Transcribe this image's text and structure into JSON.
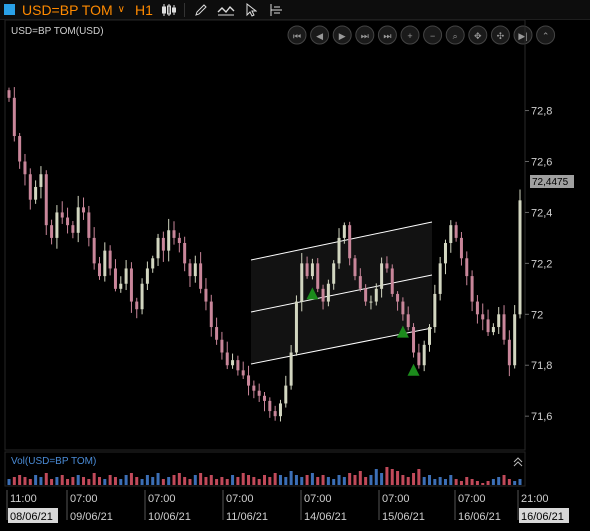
{
  "toolbar": {
    "symbol": "USD=BP TOM",
    "timeframe": "H1",
    "icons": [
      "candlestick-icon",
      "pencil-icon",
      "line-style-icon",
      "cursor-icon",
      "indicator-icon"
    ]
  },
  "chart": {
    "title": "USD=BP TOM(USD)",
    "volume_title": "Vol(USD=BP TOM)",
    "last_price": "72,4475",
    "nav_buttons": [
      "first-icon",
      "prev-icon",
      "play-icon",
      "next-icon",
      "last-icon",
      "zoom-in-icon",
      "zoom-out-icon",
      "zoom-area-icon",
      "scroll-icon",
      "fit-icon",
      "end-icon",
      "collapse-icon"
    ],
    "colors": {
      "up": "#d2d6c0",
      "down": "#c9869a",
      "vol_up": "#3c6fb6",
      "vol_down": "#c14a5a",
      "marker": "#1c8b1c",
      "last_price_bg": "#a0a0a0"
    }
  },
  "time_axis": {
    "times": [
      "11:00",
      "07:00",
      "07:00",
      "07:00",
      "07:00",
      "07:00",
      "07:00",
      "21:00"
    ],
    "dates": [
      "08/06/21",
      "09/06/21",
      "10/06/21",
      "11/06/21",
      "14/06/21",
      "15/06/21",
      "16/06/21",
      "16/06/21"
    ]
  },
  "chart_data": {
    "type": "candlestick",
    "y_ticks": [
      "72,8",
      "72,6",
      "72,4",
      "72,2",
      "72",
      "71,8",
      "71,6"
    ],
    "ylim": [
      71.53,
      72.92
    ],
    "candles": [
      72.85,
      72.7,
      72.6,
      72.55,
      72.45,
      72.5,
      72.55,
      72.35,
      72.3,
      72.4,
      72.38,
      72.35,
      72.32,
      72.42,
      72.4,
      72.3,
      72.2,
      72.15,
      72.25,
      72.18,
      72.1,
      72.12,
      72.18,
      72.05,
      72.02,
      72.12,
      72.18,
      72.22,
      72.3,
      72.25,
      72.33,
      72.3,
      72.28,
      72.2,
      72.15,
      72.2,
      72.1,
      72.05,
      71.95,
      71.9,
      71.85,
      71.8,
      71.82,
      71.78,
      71.76,
      71.72,
      71.7,
      71.68,
      71.66,
      71.62,
      71.6,
      71.65,
      71.72,
      71.85,
      72.05,
      72.2,
      72.15,
      72.2,
      72.1,
      72.05,
      72.12,
      72.2,
      72.3,
      72.35,
      72.22,
      72.15,
      72.1,
      72.05,
      72.05,
      72.1,
      72.2,
      72.18,
      72.08,
      72.05,
      72.0,
      71.95,
      71.85,
      71.8,
      71.88,
      71.95,
      72.08,
      72.2,
      72.28,
      72.35,
      72.3,
      72.22,
      72.15,
      72.05,
      72.0,
      71.98,
      71.93,
      71.95,
      72.0,
      71.9,
      71.8,
      72.0,
      72.4475
    ],
    "up_markers": [
      57,
      74,
      76
    ],
    "volumes": [
      3,
      4,
      5,
      4,
      3,
      5,
      4,
      6,
      3,
      4,
      5,
      3,
      4,
      5,
      4,
      3,
      6,
      4,
      3,
      5,
      4,
      3,
      5,
      6,
      4,
      3,
      5,
      4,
      6,
      3,
      4,
      5,
      6,
      4,
      3,
      5,
      6,
      4,
      5,
      3,
      4,
      3,
      5,
      4,
      6,
      5,
      4,
      3,
      5,
      4,
      6,
      5,
      4,
      7,
      5,
      4,
      5,
      6,
      4,
      5,
      4,
      3,
      5,
      4,
      6,
      5,
      7,
      4,
      5,
      8,
      6,
      9,
      8,
      7,
      5,
      4,
      6,
      8,
      4,
      5,
      3,
      4,
      3,
      5,
      3,
      2,
      4,
      3,
      2,
      1,
      2,
      3,
      4,
      5,
      3,
      2,
      3
    ]
  }
}
